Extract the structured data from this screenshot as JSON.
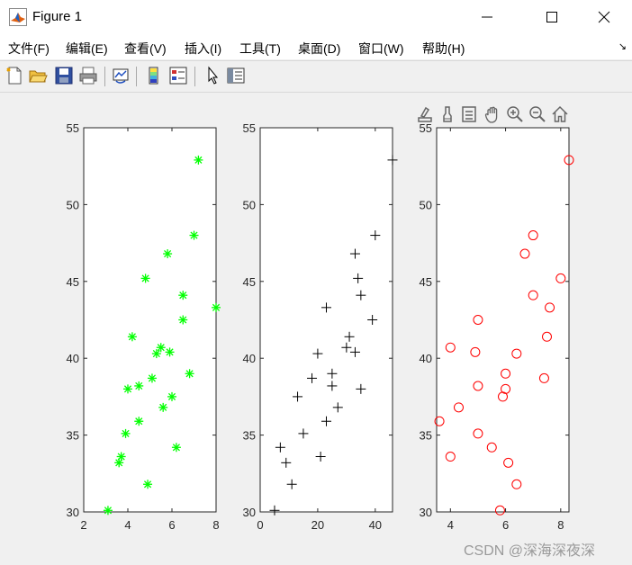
{
  "window": {
    "title": "Figure 1",
    "controls": [
      "minimize",
      "maximize",
      "close"
    ]
  },
  "menu": {
    "items": [
      "文件(F)",
      "编辑(E)",
      "查看(V)",
      "插入(I)",
      "工具(T)",
      "桌面(D)",
      "窗口(W)",
      "帮助(H)"
    ]
  },
  "toolbar": {
    "icons": [
      "new-figure-icon",
      "open-file-icon",
      "save-icon",
      "print-icon",
      "link-plot-icon",
      "colorbar-icon",
      "legend-icon",
      "pointer-icon",
      "property-inspector-icon"
    ]
  },
  "axes_toolbar": {
    "icons": [
      "export-icon",
      "brush-icon",
      "data-tips-icon",
      "pan-icon",
      "zoom-in-icon",
      "zoom-out-icon",
      "home-icon"
    ]
  },
  "watermark": "CSDN @深海深夜深",
  "chart_data": [
    {
      "type": "scatter",
      "marker": "*",
      "color": "#00ff00",
      "xlim": [
        2,
        8
      ],
      "ylim": [
        30,
        55
      ],
      "xticks": [
        "2",
        "4",
        "6",
        "8"
      ],
      "yticks": [
        "30",
        "35",
        "40",
        "45",
        "50",
        "55"
      ],
      "points": [
        [
          3.1,
          30.1
        ],
        [
          3.6,
          33.2
        ],
        [
          3.7,
          33.6
        ],
        [
          3.9,
          35.1
        ],
        [
          4.0,
          38.0
        ],
        [
          4.2,
          41.4
        ],
        [
          4.5,
          35.9
        ],
        [
          4.5,
          38.2
        ],
        [
          4.8,
          45.2
        ],
        [
          4.9,
          31.8
        ],
        [
          5.1,
          38.7
        ],
        [
          5.3,
          40.3
        ],
        [
          5.5,
          40.7
        ],
        [
          5.6,
          36.8
        ],
        [
          5.8,
          46.8
        ],
        [
          5.9,
          40.4
        ],
        [
          6.0,
          37.5
        ],
        [
          6.2,
          34.2
        ],
        [
          6.5,
          44.1
        ],
        [
          6.5,
          42.5
        ],
        [
          6.8,
          39.0
        ],
        [
          7.0,
          48.0
        ],
        [
          7.2,
          52.9
        ],
        [
          8.0,
          43.3
        ]
      ]
    },
    {
      "type": "scatter",
      "marker": "+",
      "color": "#000000",
      "xlim": [
        0,
        46
      ],
      "ylim": [
        30,
        55
      ],
      "xticks": [
        "0",
        "20",
        "40"
      ],
      "yticks": [
        "30",
        "35",
        "40",
        "45",
        "50",
        "55"
      ],
      "points": [
        [
          5,
          30.1
        ],
        [
          7,
          34.2
        ],
        [
          9,
          33.2
        ],
        [
          11,
          31.8
        ],
        [
          13,
          37.5
        ],
        [
          15,
          35.1
        ],
        [
          18,
          38.7
        ],
        [
          20,
          40.3
        ],
        [
          21,
          33.6
        ],
        [
          23,
          35.9
        ],
        [
          23,
          43.3
        ],
        [
          25,
          39.0
        ],
        [
          25,
          38.2
        ],
        [
          27,
          36.8
        ],
        [
          30,
          40.7
        ],
        [
          31,
          41.4
        ],
        [
          33,
          40.4
        ],
        [
          33,
          46.8
        ],
        [
          34,
          45.2
        ],
        [
          35,
          44.1
        ],
        [
          35,
          38.0
        ],
        [
          39,
          42.5
        ],
        [
          40,
          48.0
        ],
        [
          46,
          52.9
        ]
      ]
    },
    {
      "type": "scatter",
      "marker": "o",
      "color": "#ff0000",
      "xlim": [
        3.5,
        8.3
      ],
      "ylim": [
        30,
        55
      ],
      "xticks": [
        "4",
        "6",
        "8"
      ],
      "yticks": [
        "30",
        "35",
        "40",
        "45",
        "50",
        "55"
      ],
      "points": [
        [
          3.6,
          35.9
        ],
        [
          4.0,
          33.6
        ],
        [
          4.0,
          40.7
        ],
        [
          4.3,
          36.8
        ],
        [
          4.9,
          40.4
        ],
        [
          5.0,
          35.1
        ],
        [
          5.0,
          38.2
        ],
        [
          5.0,
          42.5
        ],
        [
          5.5,
          34.2
        ],
        [
          5.8,
          30.1
        ],
        [
          5.9,
          37.5
        ],
        [
          6.0,
          38.0
        ],
        [
          6.0,
          39.0
        ],
        [
          6.1,
          33.2
        ],
        [
          6.4,
          31.8
        ],
        [
          6.4,
          40.3
        ],
        [
          6.7,
          46.8
        ],
        [
          7.0,
          44.1
        ],
        [
          7.0,
          48.0
        ],
        [
          7.4,
          38.7
        ],
        [
          7.5,
          41.4
        ],
        [
          7.6,
          43.3
        ],
        [
          8.0,
          45.2
        ],
        [
          8.3,
          52.9
        ]
      ]
    }
  ]
}
